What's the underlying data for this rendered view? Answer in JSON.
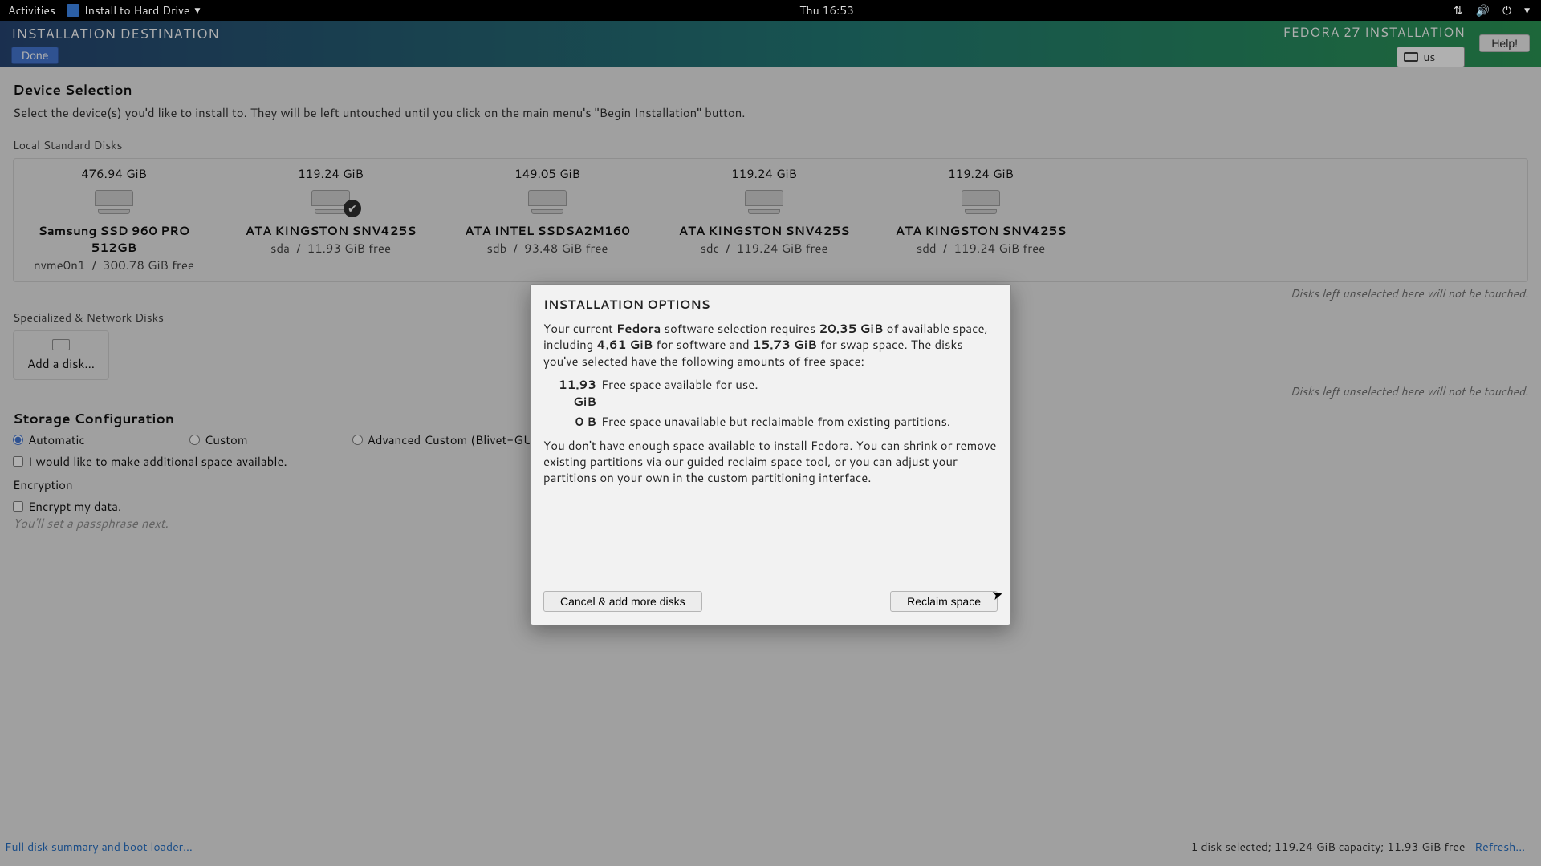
{
  "topbar": {
    "activities": "Activities",
    "app": "Install to Hard Drive",
    "clock": "Thu 16:53"
  },
  "header": {
    "title": "INSTALLATION DESTINATION",
    "done": "Done",
    "brand": "FEDORA 27 INSTALLATION",
    "lang": "us",
    "help": "Help!"
  },
  "device_selection": {
    "title": "Device Selection",
    "subtitle": "Select the device(s) you'd like to install to.  They will be left untouched until you click on the main menu's \"Begin Installation\" button."
  },
  "local_disks_label": "Local Standard Disks",
  "disks_note": "Disks left unselected here will not be touched.",
  "disks": [
    {
      "cap": "476.94 GiB",
      "name": "Samsung SSD 960 PRO 512GB",
      "dev": "nvme0n1",
      "free": "300.78 GiB free",
      "selected": false
    },
    {
      "cap": "119.24 GiB",
      "name": "ATA KINGSTON SNV425S",
      "dev": "sda",
      "free": "11.93 GiB free",
      "selected": true
    },
    {
      "cap": "149.05 GiB",
      "name": "ATA INTEL SSDSA2M160",
      "dev": "sdb",
      "free": "93.48 GiB free",
      "selected": false
    },
    {
      "cap": "119.24 GiB",
      "name": "ATA KINGSTON SNV425S",
      "dev": "sdc",
      "free": "119.24 GiB free",
      "selected": false
    },
    {
      "cap": "119.24 GiB",
      "name": "ATA KINGSTON SNV425S",
      "dev": "sdd",
      "free": "119.24 GiB free",
      "selected": false
    }
  ],
  "net_disks_label": "Specialized & Network Disks",
  "add_disk": "Add a disk...",
  "storage_conf": {
    "title": "Storage Configuration",
    "opt_auto": "Automatic",
    "opt_custom": "Custom",
    "opt_blivet": "Advanced Custom (Blivet-GUI)",
    "chk_more_space": "I would like to make additional space available.",
    "encryption": "Encryption",
    "chk_encrypt": "Encrypt my data.",
    "encrypt_hint": "You'll set a passphrase next."
  },
  "footer": {
    "summary_link": "Full disk summary and boot loader...",
    "status": "1 disk selected; 119.24 GiB capacity; 11.93 GiB free",
    "refresh": "Refresh..."
  },
  "modal": {
    "title": "INSTALLATION OPTIONS",
    "p1a": "Your current ",
    "p1_strong1": "Fedora",
    "p1b": " software selection requires ",
    "p1_strong2": "20.35 GiB",
    "p1c": " of available space, including ",
    "p1_strong3": "4.61 GiB",
    "p1d": " for software and ",
    "p1_strong4": "15.73 GiB",
    "p1e": " for swap space. The disks you've selected have the following amounts of free space:",
    "row1_amt": "11.93 GiB",
    "row1_txt": "Free space available for use.",
    "row2_amt": "0 B",
    "row2_txt": "Free space unavailable but reclaimable from existing partitions.",
    "p2": "You don't have enough space available to install Fedora.  You can shrink or remove existing partitions via our guided reclaim space tool, or you can adjust your partitions on your own in the custom partitioning interface.",
    "btn_cancel": "Cancel & add more disks",
    "btn_reclaim": "Reclaim space"
  }
}
